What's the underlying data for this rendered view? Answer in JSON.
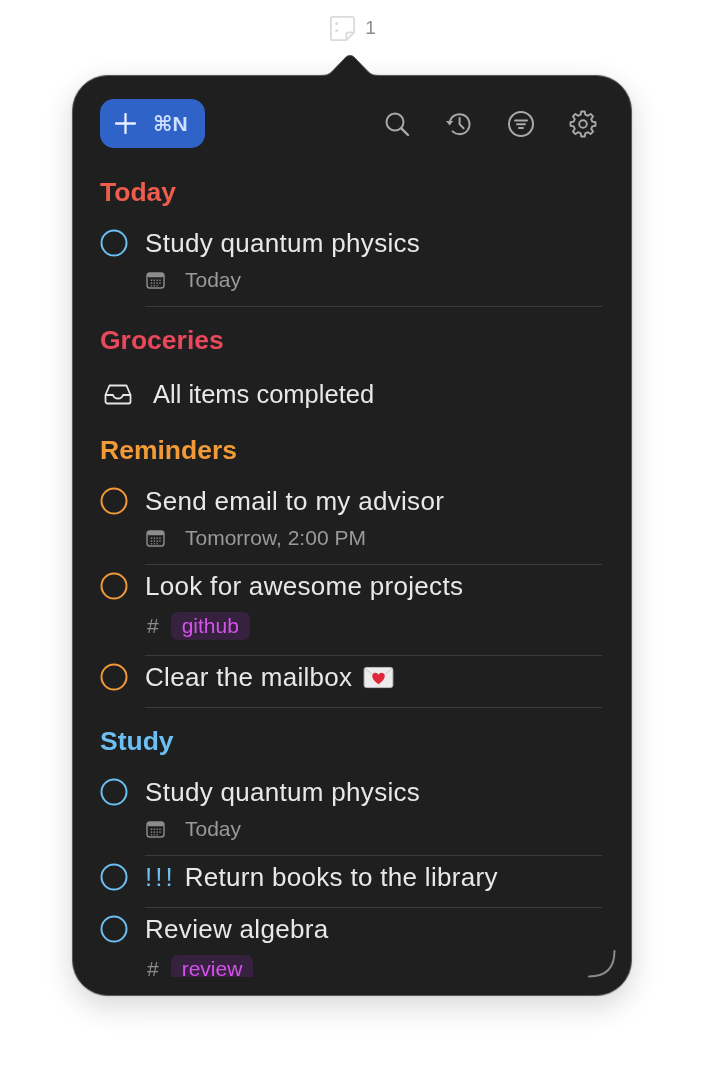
{
  "menubar": {
    "count": "1"
  },
  "toolbar": {
    "new_button": {
      "shortcut": "⌘N"
    }
  },
  "sections": [
    {
      "title": "Today",
      "color": "#ee5d4e",
      "tasks": [
        {
          "title": "Study quantum physics",
          "color": "#6cbff2",
          "checked": false,
          "emoji": false,
          "meta": {
            "kind": "date",
            "text": "Today"
          }
        }
      ]
    },
    {
      "title": "Groceries",
      "color": "#e9475c",
      "empty_text": "All items completed"
    },
    {
      "title": "Reminders",
      "color": "#f19a38",
      "tasks": [
        {
          "title": "Send email to my advisor",
          "color": "#f19a38",
          "checked": false,
          "emoji": false,
          "meta": {
            "kind": "date",
            "text": "Tomorrow, 2:00 PM"
          }
        },
        {
          "title": "Look for awesome projects",
          "color": "#f19a38",
          "checked": false,
          "emoji": false,
          "meta": {
            "kind": "tag",
            "symbol": "#",
            "text": "github"
          }
        },
        {
          "title": "Clear the mailbox",
          "color": "#f19a38",
          "checked": false,
          "emoji": true
        }
      ]
    },
    {
      "title": "Study",
      "color": "#6cbff2",
      "tasks": [
        {
          "title": "Study quantum physics",
          "color": "#6cbff2",
          "checked": false,
          "emoji": false,
          "meta": {
            "kind": "date",
            "text": "Today"
          }
        },
        {
          "priority": "!!!",
          "title": "Return books to the library",
          "color": "#6cbff2",
          "checked": false,
          "emoji": false
        },
        {
          "title": "Review algebra",
          "color": "#6cbff2",
          "checked": false,
          "emoji": false,
          "meta": {
            "kind": "tag",
            "symbol": "#",
            "text": "review"
          }
        }
      ]
    }
  ]
}
